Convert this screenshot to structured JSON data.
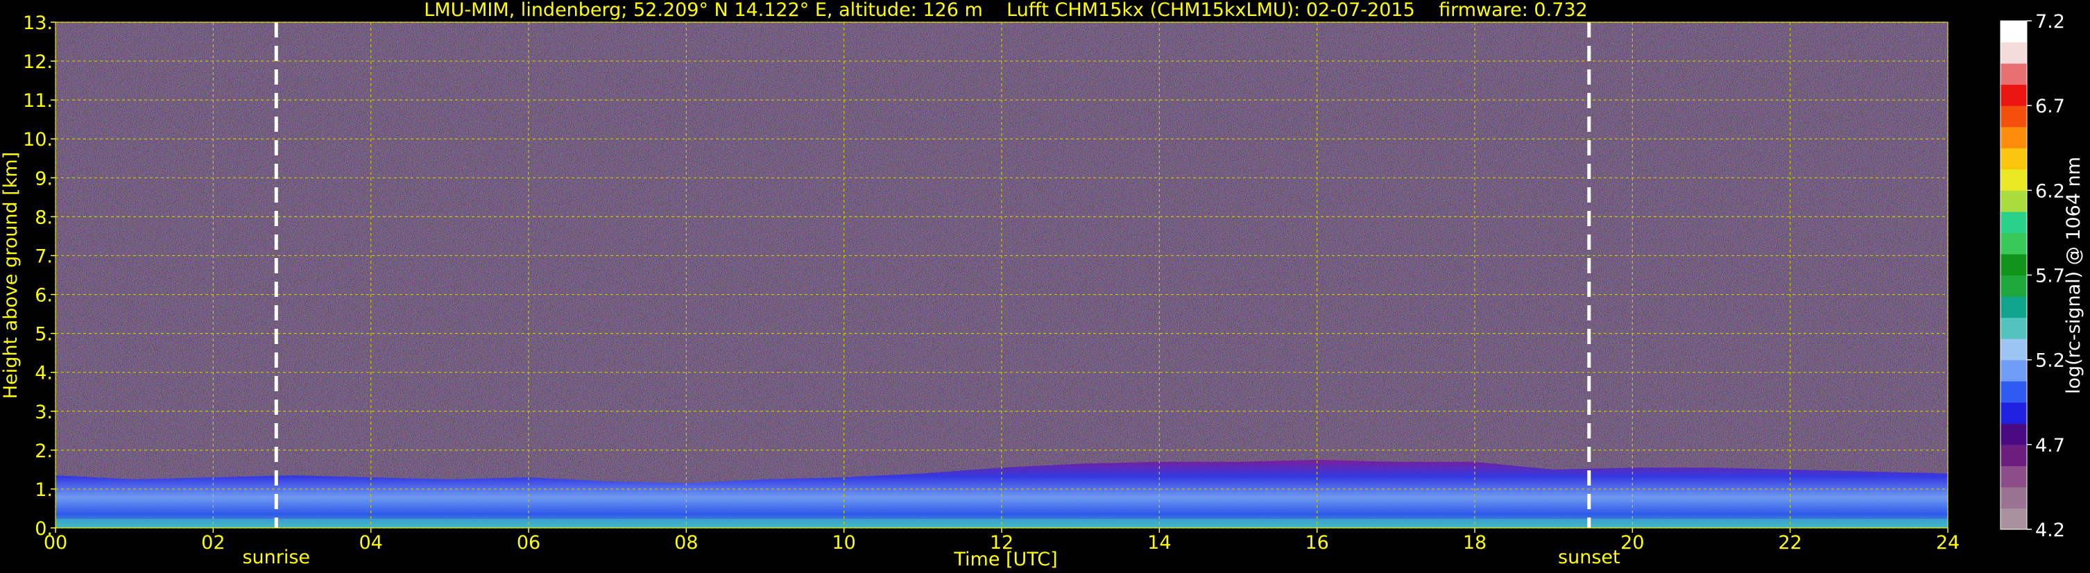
{
  "title": "LMU-MIM, lindenberg; 52.209° N 14.122° E, altitude: 126 m    Lufft CHM15kx (CHM15kxLMU): 02-07-2015    firmware: 0.732",
  "colors": {
    "background": "#000000",
    "text": "#ffff00",
    "grid": "#c8c800",
    "marker": "#ffffff",
    "colorbar_text": "#ffffff"
  },
  "chart_data": {
    "type": "heatmap",
    "xlabel": "Time [UTC]",
    "ylabel": "Height above ground [km]",
    "xlim": [
      0,
      24
    ],
    "ylim": [
      0,
      13
    ],
    "x_ticks": [
      "00",
      "02",
      "04",
      "06",
      "08",
      "10",
      "12",
      "14",
      "16",
      "18",
      "20",
      "22",
      "24"
    ],
    "y_ticks": [
      "0.",
      "1.",
      "2.",
      "3.",
      "4.",
      "5.",
      "6.",
      "7.",
      "8.",
      "9.",
      "10.",
      "11.",
      "12.",
      "13."
    ],
    "grid": true,
    "annotations": [
      {
        "label": "sunrise",
        "x": 2.8
      },
      {
        "label": "sunset",
        "x": 19.45
      }
    ],
    "colorbar": {
      "label": "log(rc-signal) @ 1064 nm",
      "range": [
        4.2,
        7.2
      ],
      "ticks": [
        "4.2",
        "4.7",
        "5.2",
        "5.7",
        "6.2",
        "6.7",
        "7.2"
      ],
      "colors": [
        "#a8909f",
        "#9a7393",
        "#8d4d88",
        "#6c1e7e",
        "#4a0a82",
        "#1e22e0",
        "#2f5bf3",
        "#6f9cf6",
        "#9cc5f4",
        "#53c4bd",
        "#11a58e",
        "#1ea83b",
        "#10941c",
        "#37c857",
        "#2ad18a",
        "#aadc3e",
        "#e9e822",
        "#fcc60e",
        "#fd8d0a",
        "#f54f0e",
        "#ea1411",
        "#e87070",
        "#f5dcdc",
        "#ffffff"
      ]
    },
    "boundary_layer_top_km": {
      "x": [
        0,
        1,
        2,
        3,
        4,
        5,
        6,
        7,
        8,
        9,
        10,
        11,
        12,
        13,
        14,
        15,
        16,
        17,
        18,
        19,
        20,
        21,
        22,
        23,
        24
      ],
      "y": [
        1.35,
        1.25,
        1.3,
        1.35,
        1.3,
        1.25,
        1.3,
        1.2,
        1.15,
        1.25,
        1.3,
        1.4,
        1.55,
        1.65,
        1.7,
        1.7,
        1.75,
        1.7,
        1.7,
        1.5,
        1.55,
        1.55,
        1.5,
        1.45,
        1.4
      ]
    }
  }
}
